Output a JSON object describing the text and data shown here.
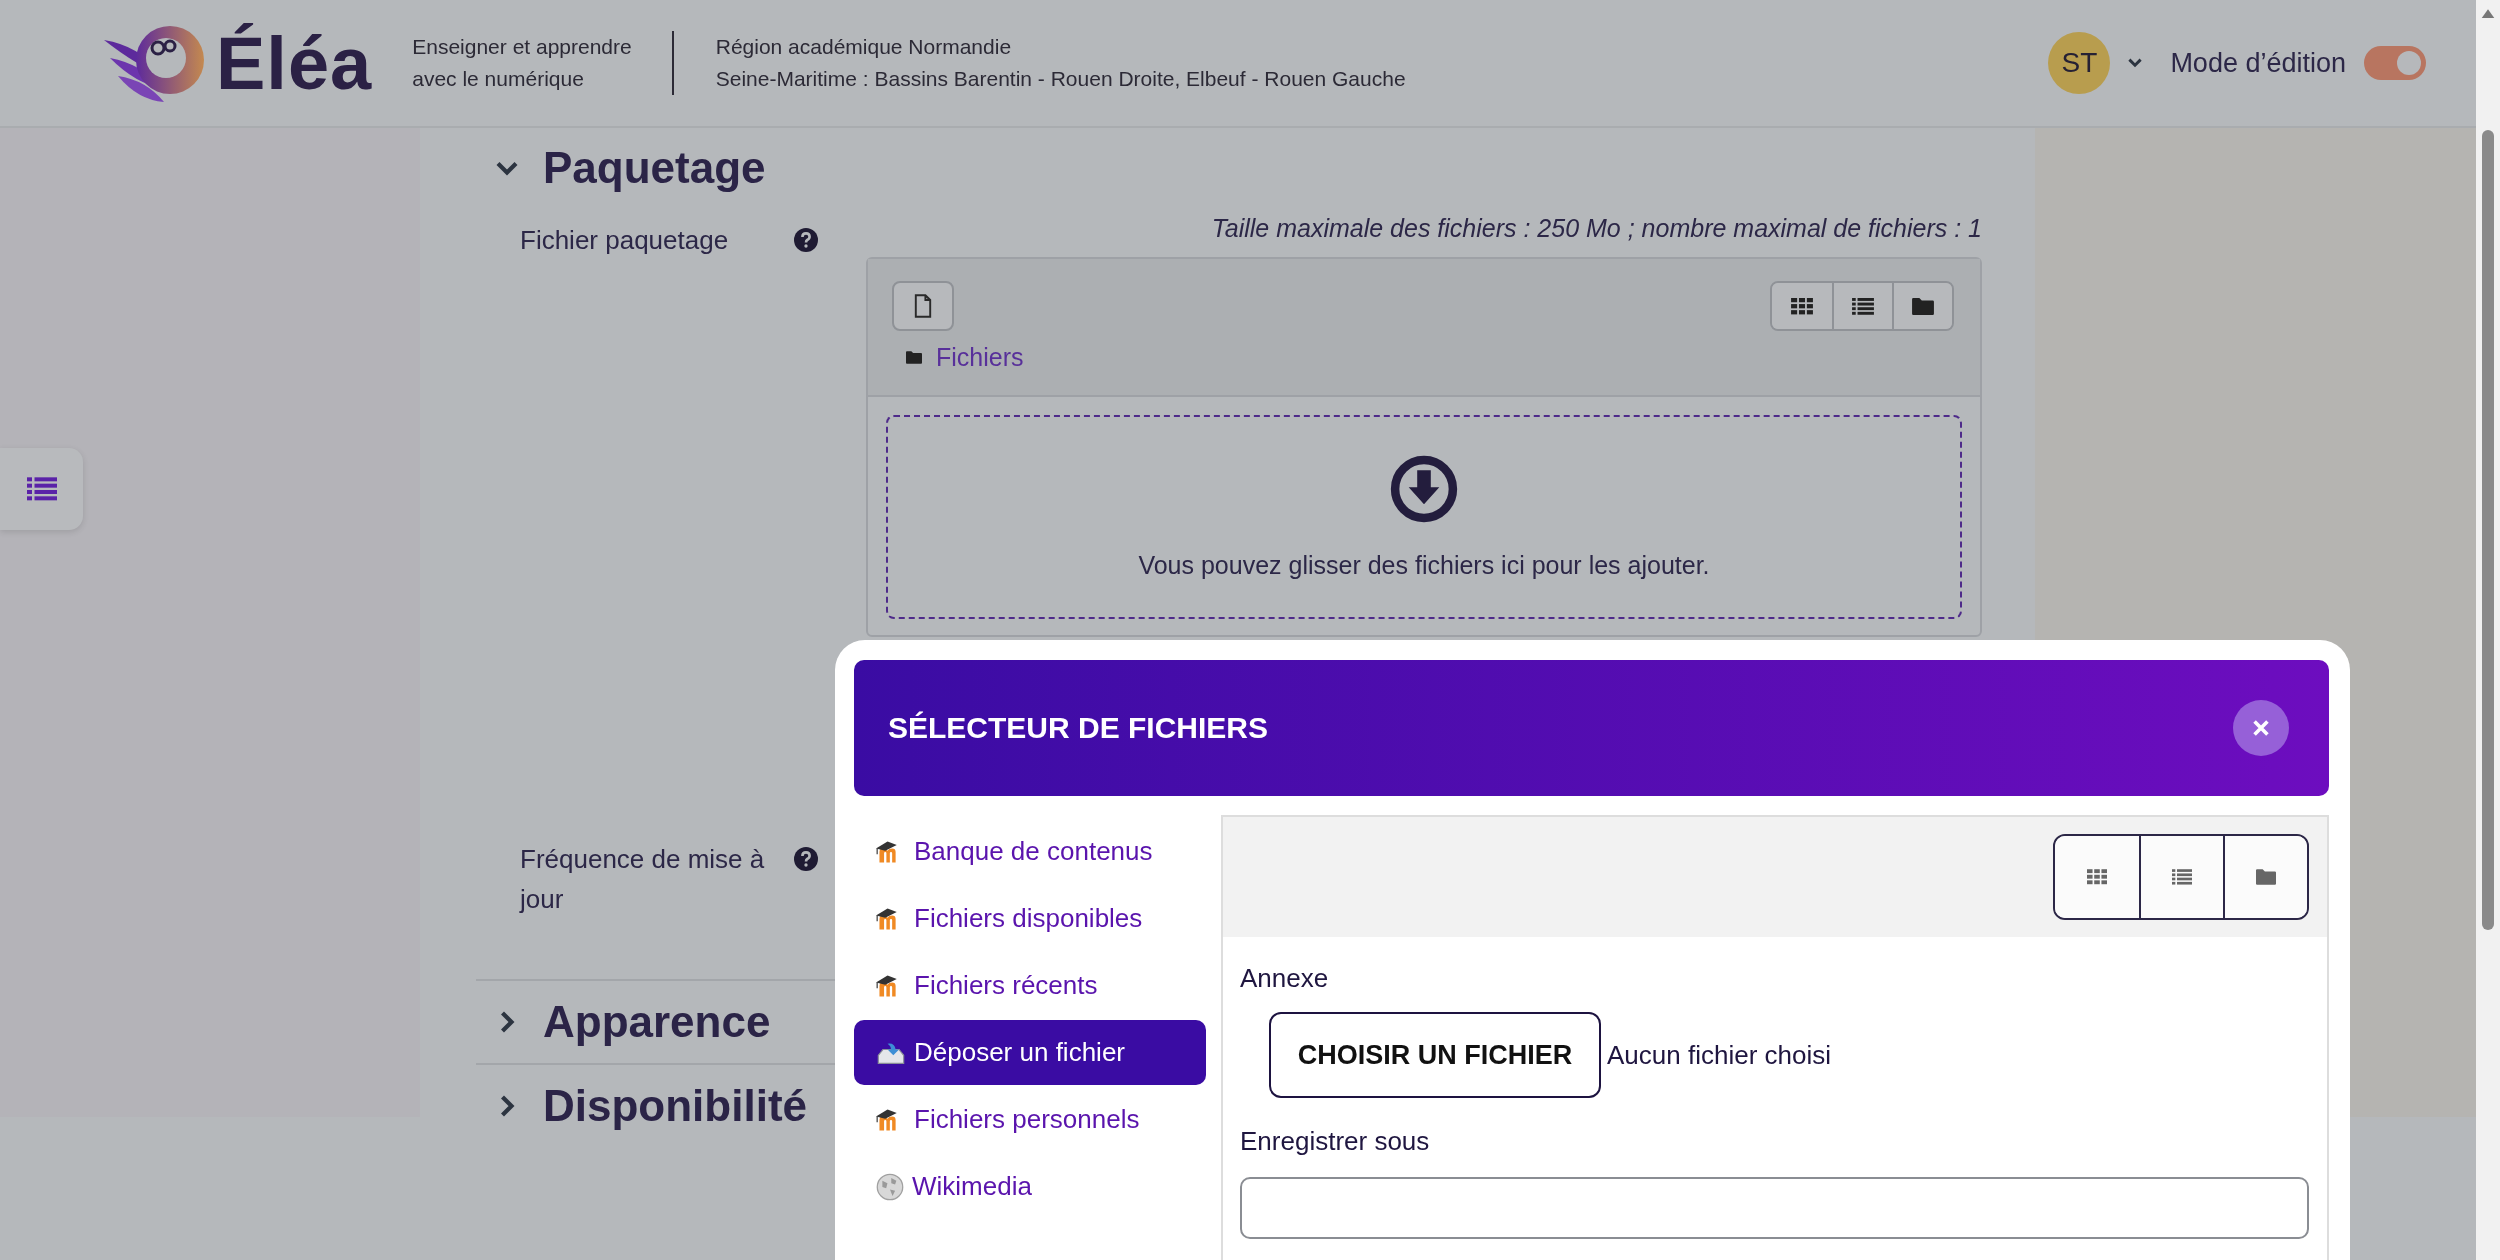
{
  "header": {
    "logo_text": "Éléa",
    "tagline_lines": [
      "Enseigner et apprendre",
      "avec le numérique"
    ],
    "region_lines": [
      "Région académique Normandie",
      "Seine-Maritime : Bassins Barentin - Rouen Droite, Elbeuf - Rouen Gauche"
    ],
    "user_initials": "ST",
    "edit_mode": {
      "label": "Mode d’édition",
      "on": true
    }
  },
  "sections": [
    {
      "title": "Paquetage",
      "expanded": true,
      "fields": [
        {
          "kind": "filemanager",
          "label": "Fichier paquetage",
          "limits": "Taille maximale des fichiers : 250 Mo ; nombre maximal de fichiers : 1",
          "path": "Fichiers",
          "drop_hint": "Vous pouvez glisser des fichiers ici pour les ajouter."
        },
        {
          "kind": "plain",
          "label": "Fréquence de mise à jour"
        }
      ]
    },
    {
      "title": "Apparence",
      "expanded": false
    },
    {
      "title": "Disponibilité",
      "expanded": false
    }
  ],
  "file_picker": {
    "title": "SÉLECTEUR DE FICHIERS",
    "repositories": [
      {
        "label": "Banque de contenus",
        "kind": "moodle",
        "selected": false
      },
      {
        "label": "Fichiers disponibles",
        "kind": "moodle",
        "selected": false
      },
      {
        "label": "Fichiers récents",
        "kind": "moodle",
        "selected": false
      },
      {
        "label": "Déposer un fichier",
        "kind": "upload",
        "selected": true
      },
      {
        "label": "Fichiers personnels",
        "kind": "moodle",
        "selected": false
      },
      {
        "label": "Wikimedia",
        "kind": "wikimedia",
        "selected": false
      }
    ],
    "upload": {
      "file_label": "Annexe",
      "choose_button": "CHOISIR UN FICHIER",
      "no_file": "Aucun fichier choisi",
      "save_as_label": "Enregistrer sous"
    }
  }
}
